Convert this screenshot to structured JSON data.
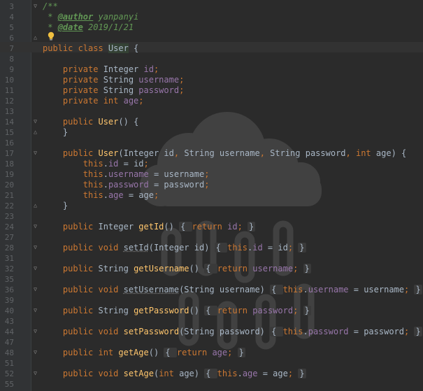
{
  "theme": {
    "background": "#2b2b2b",
    "gutter": "#313335",
    "keyword": "#cc7832",
    "field": "#9876aa",
    "method": "#ffc66d",
    "javadoc": "#629755",
    "text": "#a9b7c6"
  },
  "icons": {
    "intention": "lightbulb-icon",
    "fold_open": "fold-open-icon",
    "fold_close": "fold-close-icon",
    "watermark": "cloud-watermark"
  },
  "lines": [
    {
      "n": "3",
      "fold": "open",
      "tokens": [
        {
          "c": "doc",
          "t": "/**"
        }
      ]
    },
    {
      "n": "4",
      "tokens": [
        {
          "c": "doc",
          "t": " * "
        },
        {
          "c": "tag",
          "t": "@author"
        },
        {
          "c": "doc",
          "t": " yanpanyi"
        }
      ]
    },
    {
      "n": "5",
      "tokens": [
        {
          "c": "doc",
          "t": " * "
        },
        {
          "c": "tag",
          "t": "@date"
        },
        {
          "c": "doc",
          "t": " 2019/1/21"
        }
      ]
    },
    {
      "n": "6",
      "fold": "close",
      "tokens": [
        {
          "c": "doc",
          "t": " "
        }
      ]
    },
    {
      "n": "7",
      "tokens": [
        {
          "c": "kw",
          "t": "public class "
        },
        {
          "c": "sel-cls",
          "t": "User"
        },
        {
          "c": "tx",
          "t": " {"
        }
      ]
    },
    {
      "n": "8",
      "tokens": []
    },
    {
      "n": "9",
      "tokens": [
        {
          "c": "kw",
          "t": "    private "
        },
        {
          "c": "tx",
          "t": "Integer "
        },
        {
          "c": "fld",
          "t": "id"
        },
        {
          "c": "kw",
          "t": ";"
        }
      ]
    },
    {
      "n": "10",
      "tokens": [
        {
          "c": "kw",
          "t": "    private "
        },
        {
          "c": "tx",
          "t": "String "
        },
        {
          "c": "fld",
          "t": "username"
        },
        {
          "c": "kw",
          "t": ";"
        }
      ]
    },
    {
      "n": "11",
      "tokens": [
        {
          "c": "kw",
          "t": "    private "
        },
        {
          "c": "tx",
          "t": "String "
        },
        {
          "c": "fld",
          "t": "password"
        },
        {
          "c": "kw",
          "t": ";"
        }
      ]
    },
    {
      "n": "12",
      "tokens": [
        {
          "c": "kw",
          "t": "    private int "
        },
        {
          "c": "fld",
          "t": "age"
        },
        {
          "c": "kw",
          "t": ";"
        }
      ]
    },
    {
      "n": "13",
      "tokens": []
    },
    {
      "n": "14",
      "fold": "open",
      "tokens": [
        {
          "c": "kw",
          "t": "    public "
        },
        {
          "c": "fn",
          "t": "User"
        },
        {
          "c": "tx",
          "t": "() {"
        }
      ]
    },
    {
      "n": "15",
      "fold": "close",
      "tokens": [
        {
          "c": "tx",
          "t": "    }"
        }
      ]
    },
    {
      "n": "16",
      "tokens": []
    },
    {
      "n": "17",
      "fold": "open",
      "tokens": [
        {
          "c": "kw",
          "t": "    public "
        },
        {
          "c": "fn",
          "t": "User"
        },
        {
          "c": "tx",
          "t": "(Integer id"
        },
        {
          "c": "kw",
          "t": ", "
        },
        {
          "c": "tx",
          "t": "String username"
        },
        {
          "c": "kw",
          "t": ", "
        },
        {
          "c": "tx",
          "t": "String password"
        },
        {
          "c": "kw",
          "t": ", int "
        },
        {
          "c": "tx",
          "t": "age) {"
        }
      ]
    },
    {
      "n": "18",
      "tokens": [
        {
          "c": "kw",
          "t": "        this"
        },
        {
          "c": "tx",
          "t": "."
        },
        {
          "c": "fld",
          "t": "id"
        },
        {
          "c": "tx",
          "t": " = id"
        },
        {
          "c": "kw",
          "t": ";"
        }
      ]
    },
    {
      "n": "19",
      "tokens": [
        {
          "c": "kw",
          "t": "        this"
        },
        {
          "c": "tx",
          "t": "."
        },
        {
          "c": "fld",
          "t": "username"
        },
        {
          "c": "tx",
          "t": " = username"
        },
        {
          "c": "kw",
          "t": ";"
        }
      ]
    },
    {
      "n": "20",
      "tokens": [
        {
          "c": "kw",
          "t": "        this"
        },
        {
          "c": "tx",
          "t": "."
        },
        {
          "c": "fld",
          "t": "password"
        },
        {
          "c": "tx",
          "t": " = password"
        },
        {
          "c": "kw",
          "t": ";"
        }
      ]
    },
    {
      "n": "21",
      "tokens": [
        {
          "c": "kw",
          "t": "        this"
        },
        {
          "c": "tx",
          "t": "."
        },
        {
          "c": "fld",
          "t": "age"
        },
        {
          "c": "tx",
          "t": " = age"
        },
        {
          "c": "kw",
          "t": ";"
        }
      ]
    },
    {
      "n": "22",
      "fold": "close",
      "tokens": [
        {
          "c": "tx",
          "t": "    }"
        }
      ]
    },
    {
      "n": "23",
      "tokens": []
    },
    {
      "n": "24",
      "fold": "open",
      "tokens": [
        {
          "c": "kw",
          "t": "    public "
        },
        {
          "c": "tx",
          "t": "Integer "
        },
        {
          "c": "fn",
          "t": "getId"
        },
        {
          "c": "tx",
          "t": "() "
        },
        {
          "c": "fold-region",
          "t": "{ "
        },
        {
          "c": "kw",
          "t": "return "
        },
        {
          "c": "fld",
          "t": "id"
        },
        {
          "c": "kw",
          "t": "; "
        },
        {
          "c": "fold-region",
          "t": "}"
        }
      ]
    },
    {
      "n": "27",
      "tokens": []
    },
    {
      "n": "28",
      "fold": "open",
      "tokens": [
        {
          "c": "kw",
          "t": "    public void "
        },
        {
          "c": "unused",
          "t": "setId"
        },
        {
          "c": "tx",
          "t": "(Integer id) "
        },
        {
          "c": "fold-region",
          "t": "{ "
        },
        {
          "c": "kw",
          "t": "this"
        },
        {
          "c": "tx",
          "t": "."
        },
        {
          "c": "fld",
          "t": "id"
        },
        {
          "c": "tx",
          "t": " = id"
        },
        {
          "c": "kw",
          "t": "; "
        },
        {
          "c": "fold-region",
          "t": "}"
        }
      ]
    },
    {
      "n": "31",
      "tokens": []
    },
    {
      "n": "32",
      "fold": "open",
      "tokens": [
        {
          "c": "kw",
          "t": "    public "
        },
        {
          "c": "tx",
          "t": "String "
        },
        {
          "c": "fn",
          "t": "getUsername"
        },
        {
          "c": "tx",
          "t": "() "
        },
        {
          "c": "fold-region",
          "t": "{ "
        },
        {
          "c": "kw",
          "t": "return "
        },
        {
          "c": "fld",
          "t": "username"
        },
        {
          "c": "kw",
          "t": "; "
        },
        {
          "c": "fold-region",
          "t": "}"
        }
      ]
    },
    {
      "n": "35",
      "tokens": []
    },
    {
      "n": "36",
      "fold": "open",
      "tokens": [
        {
          "c": "kw",
          "t": "    public void "
        },
        {
          "c": "unused",
          "t": "setUsername"
        },
        {
          "c": "tx",
          "t": "(String username) "
        },
        {
          "c": "fold-region",
          "t": "{ "
        },
        {
          "c": "kw",
          "t": "this"
        },
        {
          "c": "tx",
          "t": "."
        },
        {
          "c": "fld",
          "t": "username"
        },
        {
          "c": "tx",
          "t": " = username"
        },
        {
          "c": "kw",
          "t": "; "
        },
        {
          "c": "fold-region",
          "t": "}"
        }
      ]
    },
    {
      "n": "39",
      "tokens": []
    },
    {
      "n": "40",
      "fold": "open",
      "tokens": [
        {
          "c": "kw",
          "t": "    public "
        },
        {
          "c": "tx",
          "t": "String "
        },
        {
          "c": "fn",
          "t": "getPassword"
        },
        {
          "c": "tx",
          "t": "() "
        },
        {
          "c": "fold-region",
          "t": "{ "
        },
        {
          "c": "kw",
          "t": "return "
        },
        {
          "c": "fld",
          "t": "password"
        },
        {
          "c": "kw",
          "t": "; "
        },
        {
          "c": "fold-region",
          "t": "}"
        }
      ]
    },
    {
      "n": "43",
      "tokens": []
    },
    {
      "n": "44",
      "fold": "open",
      "tokens": [
        {
          "c": "kw",
          "t": "    public void "
        },
        {
          "c": "fn",
          "t": "setPassword"
        },
        {
          "c": "tx",
          "t": "(String password) "
        },
        {
          "c": "fold-region",
          "t": "{ "
        },
        {
          "c": "kw",
          "t": "this"
        },
        {
          "c": "tx",
          "t": "."
        },
        {
          "c": "fld",
          "t": "password"
        },
        {
          "c": "tx",
          "t": " = password"
        },
        {
          "c": "kw",
          "t": "; "
        },
        {
          "c": "fold-region",
          "t": "}"
        }
      ]
    },
    {
      "n": "47",
      "tokens": []
    },
    {
      "n": "48",
      "fold": "open",
      "tokens": [
        {
          "c": "kw",
          "t": "    public int "
        },
        {
          "c": "fn",
          "t": "getAge"
        },
        {
          "c": "tx",
          "t": "() "
        },
        {
          "c": "fold-region",
          "t": "{ "
        },
        {
          "c": "kw",
          "t": "return "
        },
        {
          "c": "fld",
          "t": "age"
        },
        {
          "c": "kw",
          "t": "; "
        },
        {
          "c": "fold-region",
          "t": "}"
        }
      ]
    },
    {
      "n": "51",
      "tokens": []
    },
    {
      "n": "52",
      "fold": "open",
      "tokens": [
        {
          "c": "kw",
          "t": "    public void "
        },
        {
          "c": "fn",
          "t": "setAge"
        },
        {
          "c": "tx",
          "t": "("
        },
        {
          "c": "kw",
          "t": "int "
        },
        {
          "c": "tx",
          "t": "age) "
        },
        {
          "c": "fold-region",
          "t": "{ "
        },
        {
          "c": "kw",
          "t": "this"
        },
        {
          "c": "tx",
          "t": "."
        },
        {
          "c": "fld",
          "t": "age"
        },
        {
          "c": "tx",
          "t": " = age"
        },
        {
          "c": "kw",
          "t": "; "
        },
        {
          "c": "fold-region",
          "t": "}"
        }
      ]
    },
    {
      "n": "55",
      "tokens": []
    }
  ]
}
